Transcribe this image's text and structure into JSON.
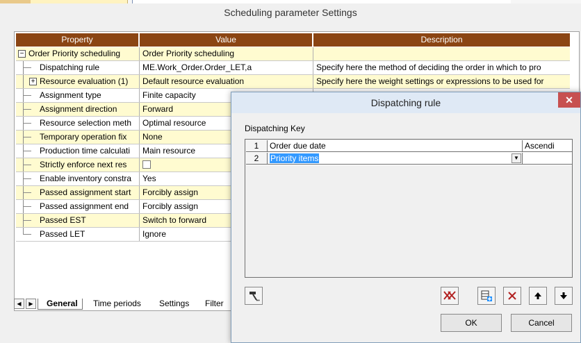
{
  "window": {
    "title": "Scheduling parameter Settings"
  },
  "grid": {
    "headers": {
      "property": "Property",
      "value": "Value",
      "description": "Description"
    },
    "rows": [
      {
        "property": "Order Priority scheduling",
        "value": "Order Priority scheduling",
        "description": ""
      },
      {
        "property": "Dispatching rule",
        "value": "ME.Work_Order.Order_LET,a",
        "description": "Specify here the method of deciding the order in which to pro"
      },
      {
        "property": "Resource evaluation (1)",
        "value": "Default resource evaluation",
        "description": "Specify here the weight settings or expressions to be used for"
      },
      {
        "property": "Assignment type",
        "value": "Finite capacity",
        "description": ""
      },
      {
        "property": "Assignment direction",
        "value": "Forward",
        "description": ""
      },
      {
        "property": "Resource selection meth",
        "value": "Optimal resource",
        "description": ""
      },
      {
        "property": "Temporary operation fix",
        "value": "None",
        "description": ""
      },
      {
        "property": "Production time calculati",
        "value": "Main resource",
        "description": ""
      },
      {
        "property": "Strictly enforce next res",
        "value": "",
        "description": ""
      },
      {
        "property": "Enable inventory constra",
        "value": "Yes",
        "description": ""
      },
      {
        "property": "Passed assignment start",
        "value": "Forcibly assign",
        "description": ""
      },
      {
        "property": "Passed assignment end",
        "value": "Forcibly assign",
        "description": ""
      },
      {
        "property": "Passed EST",
        "value": "Switch to forward",
        "description": ""
      },
      {
        "property": "Passed LET",
        "value": "Ignore",
        "description": ""
      }
    ]
  },
  "tabs": {
    "general": "General",
    "time_periods": "Time periods",
    "settings": "Settings",
    "filter": "Filter"
  },
  "dialog": {
    "title": "Dispatching rule",
    "close_label": "✕",
    "section_label": "Dispatching Key",
    "keys": [
      {
        "num": "1",
        "key": "Order due date",
        "order": "Ascendi"
      },
      {
        "num": "2",
        "key": "Priority items",
        "order": ""
      }
    ],
    "ok_label": "OK",
    "cancel_label": "Cancel"
  },
  "colors": {
    "header_bg": "#8b4513",
    "row_highlight": "#fffbd0",
    "selection": "#3399ff",
    "close_red": "#c75050"
  }
}
